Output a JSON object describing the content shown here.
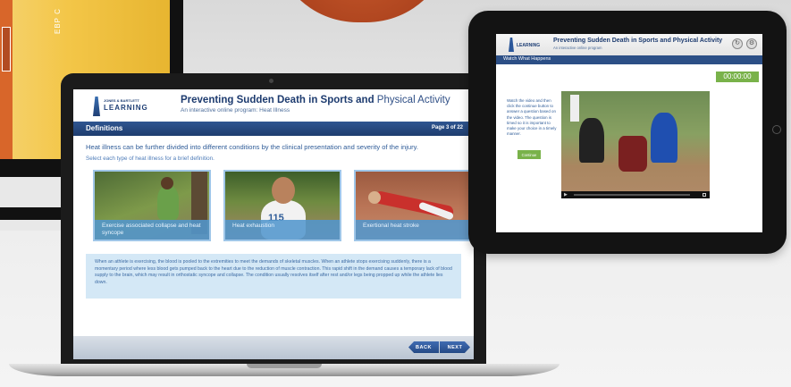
{
  "monitor": {
    "vertical_text": "EBP C"
  },
  "laptop": {
    "logo": {
      "line1": "JONES & BARTLETT",
      "line2": "LEARNING"
    },
    "title_bold": "Preventing Sudden Death in Sports and",
    "title_light": " Physical Activity",
    "subtitle": "An interactive online program: Heat Illness",
    "section": "Definitions",
    "page": "Page 3 of 22",
    "intro": "Heat illness can be further divided into different conditions by the clinical presentation and severity of the injury.",
    "instruction": "Select each type of heat illness for a brief definition.",
    "cards": [
      {
        "caption": "Exercise associated collapse and heat syncope"
      },
      {
        "caption": "Heat exhaustion",
        "bib": "115"
      },
      {
        "caption": "Exertional heat stroke"
      }
    ],
    "description": "When an athlete is exercising, the blood is pooled to the extremities to meet the demands of skeletal muscles. When an athlete stops exercising suddenly, there is a momentary period where less blood gets pumped back to the heart due to the reduction of muscle contraction. This rapid shift in the demand causes a temporary lack of blood supply to the brain, which may result in orthostatic syncope and collapse. The condition usually resolves itself after rest and/or legs being propped up while the athlete lies down.",
    "back_label": "BACK",
    "next_label": "NEXT"
  },
  "tablet": {
    "logo": "LEARNING",
    "title": "Preventing Sudden Death in Sports and Physical Activity",
    "subtitle": "An interactive online program",
    "section": "Watch What Happens",
    "timer": "00:00:00",
    "instruction": "Watch the video and then click the continue button to answer a question based on the video. The question is timed so it is important to make your choice in a timely manner.",
    "continue_label": "Continue",
    "icons": [
      "refresh-icon",
      "settings-icon"
    ]
  }
}
